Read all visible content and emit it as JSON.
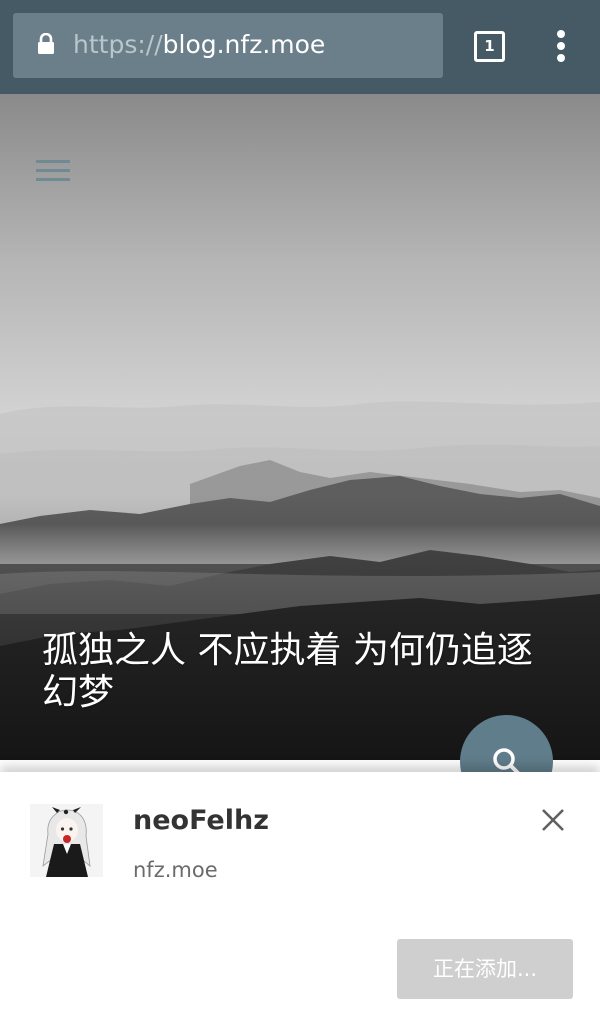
{
  "browser": {
    "url_scheme": "https://",
    "url_host": "blog.nfz.moe",
    "tab_count": "1",
    "icons": {
      "lock": "lock-icon",
      "tabs": "tab-switcher-icon",
      "menu": "overflow-menu-icon"
    }
  },
  "hero": {
    "title": "孤独之人 不应执着 为何仍追逐幻梦",
    "icons": {
      "menu": "hamburger-icon",
      "search": "search-icon"
    }
  },
  "add_to_home_sheet": {
    "app_name": "neoFelhz",
    "app_url": "nfz.moe",
    "add_button_label": "正在添加...",
    "icons": {
      "close": "close-icon",
      "avatar": "anime-girl-avatar"
    }
  },
  "colors": {
    "toolbar": "#455a64",
    "urlbar": "#6a7f89",
    "fab": "#607d8b",
    "button_disabled": "#cfcfcf"
  }
}
